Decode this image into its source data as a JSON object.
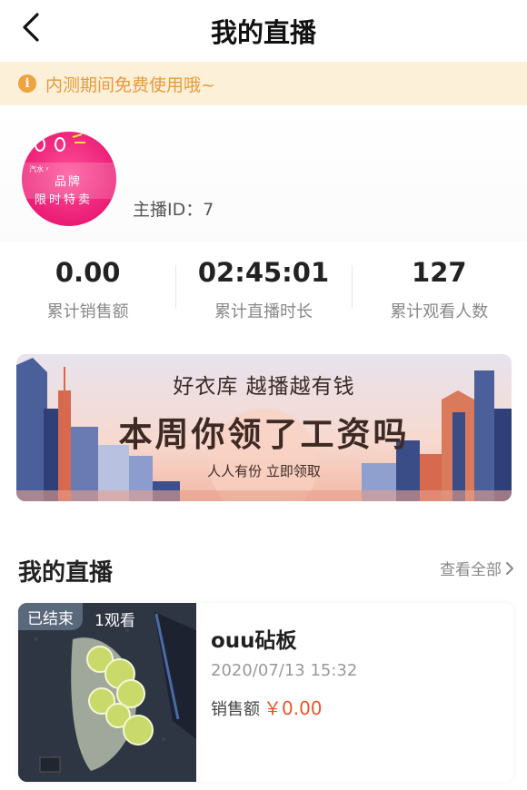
{
  "header": {
    "title": "我的直播",
    "back_icon": "chevron-left-icon"
  },
  "notice": {
    "icon": "info-icon",
    "icon_glyph": "i",
    "text": "内测期间免费使用哦~",
    "color": "#e79a3a",
    "background": "#fdf0d9"
  },
  "profile": {
    "avatar": {
      "line1": "品牌",
      "line2": "限时特卖",
      "small": "汽水 ʸ"
    },
    "host_id_label": "主播ID：",
    "host_id_value": "7"
  },
  "stats": [
    {
      "value": "0.00",
      "label": "累计销售额"
    },
    {
      "value": "02:45:01",
      "label": "累计直播时长"
    },
    {
      "value": "127",
      "label": "累计观看人数"
    }
  ],
  "banner": {
    "line1": "好衣库 越播越有钱",
    "line2": "本周你领了工资吗",
    "line3": "人人有份 立即领取"
  },
  "section": {
    "title": "我的直播",
    "view_all": "查看全部"
  },
  "live_card": {
    "status": "已结束",
    "views": "1观看",
    "title": "ouu砧板",
    "date": "2020/07/13 15:32",
    "sales_label": "销售额",
    "sales_value": "￥0.00",
    "accent": "#f0532a"
  }
}
